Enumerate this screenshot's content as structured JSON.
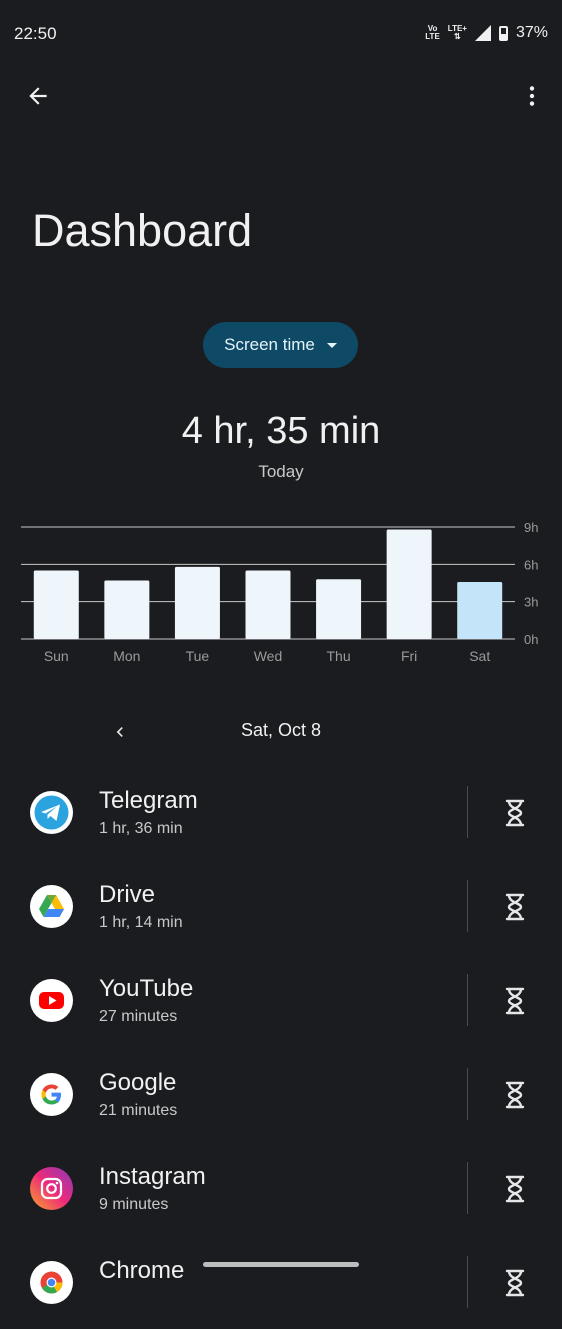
{
  "status_bar": {
    "time": "22:50",
    "volte": "Vo LTE",
    "lte": "LTE+",
    "battery_percent": "37%",
    "icons": [
      "volte-icon",
      "lte-icon",
      "signal-icon",
      "battery-icon"
    ]
  },
  "top_bar": {
    "back_icon": "arrow-back-icon",
    "more_icon": "more-vert-icon"
  },
  "page": {
    "title": "Dashboard"
  },
  "metric_selector": {
    "label": "Screen time",
    "icon": "caret-down-icon"
  },
  "summary": {
    "total": "4 hr, 35 min",
    "period": "Today"
  },
  "chart_data": {
    "type": "bar",
    "categories": [
      "Sun",
      "Mon",
      "Tue",
      "Wed",
      "Thu",
      "Fri",
      "Sat"
    ],
    "values": [
      5.5,
      4.7,
      5.8,
      5.5,
      4.8,
      8.8,
      4.58
    ],
    "highlight_index": 6,
    "y_ticks": [
      "0h",
      "3h",
      "6h",
      "9h"
    ],
    "ylim": [
      0,
      9
    ],
    "colors": {
      "bar": "#eef6fc",
      "highlight": "#c4e4fa",
      "grid": "#c8c8c8"
    }
  },
  "date_nav": {
    "prev_icon": "chevron-left-icon",
    "label": "Sat, Oct 8"
  },
  "apps": [
    {
      "name": "Telegram",
      "time": "1 hr, 36 min",
      "icon": "telegram-icon"
    },
    {
      "name": "Drive",
      "time": "1 hr, 14 min",
      "icon": "drive-icon"
    },
    {
      "name": "YouTube",
      "time": "27 minutes",
      "icon": "youtube-icon"
    },
    {
      "name": "Google",
      "time": "21 minutes",
      "icon": "google-icon"
    },
    {
      "name": "Instagram",
      "time": "9 minutes",
      "icon": "instagram-icon"
    },
    {
      "name": "Chrome",
      "time": "",
      "icon": "chrome-icon"
    }
  ]
}
